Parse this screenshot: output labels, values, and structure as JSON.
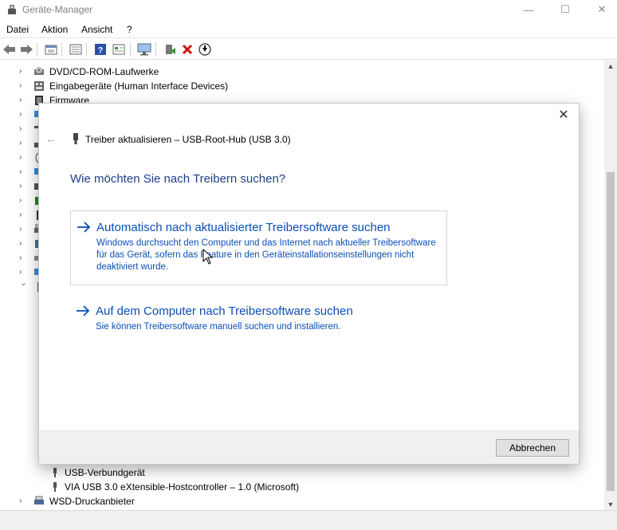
{
  "window": {
    "title": "Geräte-Manager",
    "controls": {
      "minimize": "—",
      "maximize": "☐",
      "close": "✕"
    }
  },
  "menu": [
    "Datei",
    "Aktion",
    "Ansicht",
    "?"
  ],
  "toolbar_icons": [
    "back-arrow-icon",
    "forward-arrow-icon",
    "properties-icon",
    "list-icon",
    "help-icon",
    "view-icon",
    "monitor-icon",
    "update-driver-icon",
    "uninstall-icon",
    "download-icon"
  ],
  "tree": {
    "top_items": [
      {
        "label": "DVD/CD-ROM-Laufwerke",
        "icon": "dvd-drive-icon"
      },
      {
        "label": "Eingabegeräte (Human Interface Devices)",
        "icon": "hid-icon"
      },
      {
        "label": "Firmware",
        "icon": "firmware-icon"
      }
    ],
    "bottom_items": [
      {
        "label": "USB-Verbundgerät",
        "icon": "usb-icon"
      },
      {
        "label": "VIA USB 3.0 eXtensible-Hostcontroller – 1.0 (Microsoft)",
        "icon": "usb-icon"
      },
      {
        "label": "WSD-Druckanbieter",
        "icon": "printer-icon"
      }
    ]
  },
  "dialog": {
    "title": "Treiber aktualisieren – USB-Root-Hub (USB 3.0)",
    "heading": "Wie möchten Sie nach Treibern suchen?",
    "options": [
      {
        "title": "Automatisch nach aktualisierter Treibersoftware suchen",
        "description": "Windows durchsucht den Computer und das Internet nach aktueller Treibersoftware für das Gerät, sofern das Feature in den Geräteinstallationseinstellungen nicht deaktiviert wurde."
      },
      {
        "title": "Auf dem Computer nach Treibersoftware suchen",
        "description": "Sie können Treibersoftware manuell suchen und installieren."
      }
    ],
    "cancel_label": "Abbrechen",
    "close_glyph": "✕",
    "back_glyph": "←"
  },
  "colors": {
    "link_blue": "#0a4fb5",
    "heading_blue": "#1e3f8a",
    "uninstall_red": "#d01010"
  }
}
